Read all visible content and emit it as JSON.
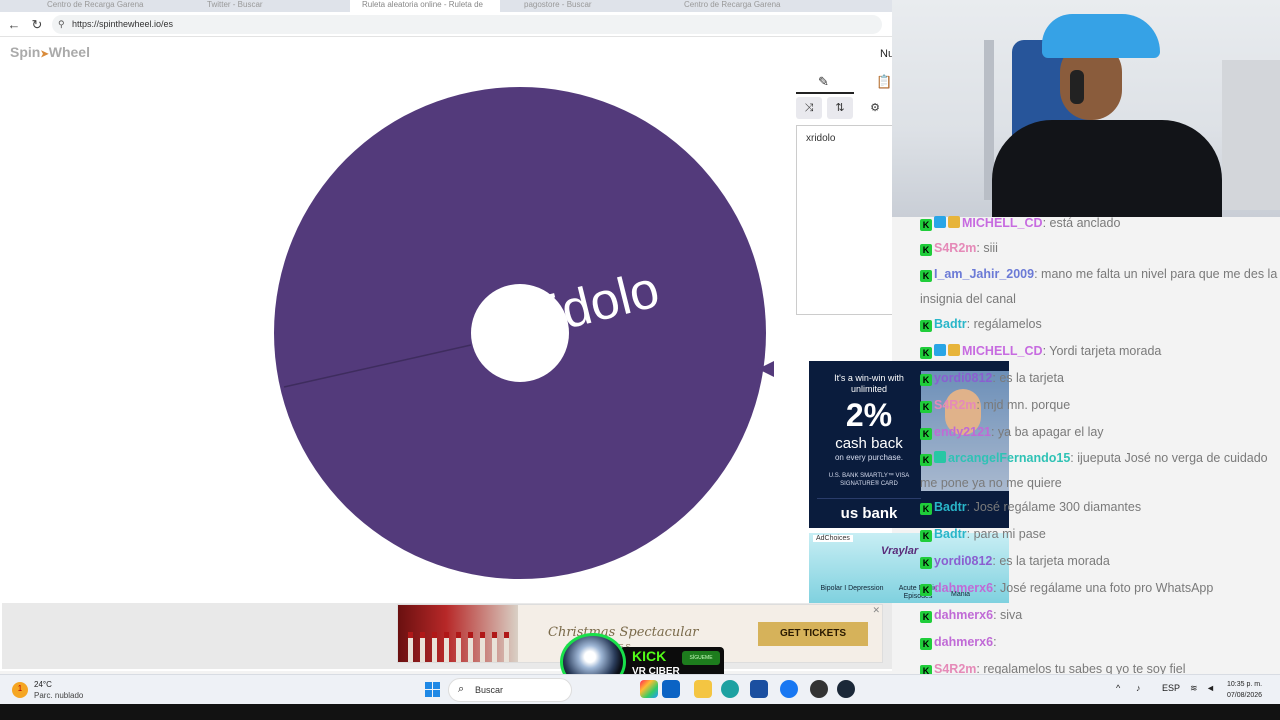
{
  "browser": {
    "tabs": [
      "Centro de Recarga Garena",
      "Twitter - Buscar",
      "Ruleta aleatoria online - Ruleta de",
      "pagostore - Buscar",
      "Centro de Recarga Garena"
    ],
    "url": "https://spinthewheel.io/es"
  },
  "app": {
    "logo": "Spin",
    "logo_arrow": "➤",
    "logo_rest": "Wheel",
    "menu_partial": "Nu"
  },
  "wheel": {
    "entries": [
      "xridolo"
    ],
    "color": "#533a7b"
  },
  "side_panel": {
    "entries_text": "xridolo",
    "icons": [
      "pencil-icon",
      "clipboard-icon",
      "shuffle-icon",
      "sort-icon",
      "settings-icon"
    ]
  },
  "bottom_ad": {
    "title": "Christmas Spectacular",
    "subtitle": "ROCKETTES",
    "cta": "GET TICKETS"
  },
  "kick_overlay": {
    "title": "KICK",
    "name": "VR CIBER",
    "follow": "SÍGUEME"
  },
  "usbank_ad": {
    "line1": "It's a win-win with unlimited",
    "big": "2%",
    "line2": "cash back",
    "line3": "on every purchase.",
    "line4": "U.S. BANK SMARTLY™ VISA SIGNATURE® CARD",
    "logo": "us bank"
  },
  "vraylar_ad": {
    "adchoices": "AdChoices",
    "brand": "Vraylar",
    "col1": "Bipolar I Depression",
    "col2": "Acute Manic Episodes",
    "col3": "Mania"
  },
  "chat": [
    {
      "user": "MICHELL_CD",
      "color": "#c76be0",
      "badges": [
        "blue",
        "gold"
      ],
      "text": ": está anclado"
    },
    {
      "user": "S4R2m",
      "color": "#e58ab8",
      "badges": [],
      "text": ": siii"
    },
    {
      "user": "I_am_Jahir_2009",
      "color": "#6b7ad6",
      "badges": [],
      "text": ": mano me falta un nivel para que me des la insignia del canal"
    },
    {
      "user": "Badtr",
      "color": "#29b6c9",
      "badges": [],
      "text": ": regálamelos"
    },
    {
      "user": "MICHELL_CD",
      "color": "#c76be0",
      "badges": [
        "blue",
        "gold"
      ],
      "text": ": Yordi tarjeta morada"
    },
    {
      "user": "yordi0812",
      "color": "#8a5fd0",
      "badges": [],
      "text": ": es la tarjeta"
    },
    {
      "user": "S4R2m",
      "color": "#e58ab8",
      "badges": [],
      "text": ": mjd mn. porque"
    },
    {
      "user": "endy2121",
      "color": "#c06ad6",
      "badges": [],
      "text": ": ya ba apagar el lay"
    },
    {
      "user": "arcangelFernando15",
      "color": "#2fc2b5",
      "badges": [
        "teal"
      ],
      "text": ": ijueputa José no verga de cuidado me pone ya no me quiere"
    },
    {
      "user": "Badtr",
      "color": "#29b6c9",
      "badges": [],
      "text": ": José regálame 300 diamantes"
    },
    {
      "user": "Badtr",
      "color": "#29b6c9",
      "badges": [],
      "text": ": para mi pase"
    },
    {
      "user": "yordi0812",
      "color": "#8a5fd0",
      "badges": [],
      "text": ": es la tarjeta morada"
    },
    {
      "user": "dahmerx6",
      "color": "#c06ad6",
      "badges": [],
      "text": ": José regálame una foto pro WhatsApp"
    },
    {
      "user": "dahmerx6",
      "color": "#c06ad6",
      "badges": [],
      "text": ": siva"
    },
    {
      "user": "dahmerx6",
      "color": "#c06ad6",
      "badges": [],
      "text": ":"
    },
    {
      "user": "S4R2m",
      "color": "#e58ab8",
      "badges": [],
      "text": ": regalamelos tu sabes q yo te soy fiel"
    }
  ],
  "taskbar": {
    "weather_temp": "24°C",
    "weather_desc": "Parc. nublado",
    "search_label": "Buscar",
    "lang": "ESP",
    "time": "10:35 p. m.",
    "date": "07/08/2026"
  }
}
